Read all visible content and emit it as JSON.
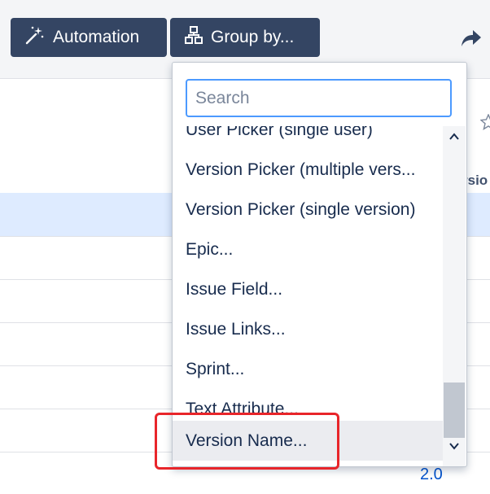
{
  "toolbar": {
    "automation_label": "Automation",
    "groupby_label": "Group by..."
  },
  "table": {
    "column_header_fragment": "rsio",
    "visible_value": "2.0"
  },
  "dropdown": {
    "search_placeholder": "Search",
    "items": [
      {
        "label": "User Picker (single user)"
      },
      {
        "label": "Version Picker (multiple vers..."
      },
      {
        "label": "Version Picker (single version)"
      },
      {
        "label": "Epic..."
      },
      {
        "label": "Issue Field..."
      },
      {
        "label": "Issue Links..."
      },
      {
        "label": "Sprint..."
      },
      {
        "label": "Text Attribute..."
      },
      {
        "label": "Version Name..."
      }
    ],
    "hovered_item": "Version Name..."
  },
  "icons": [
    "magic-wand-icon",
    "hierarchy-icon",
    "share-icon",
    "star-icon",
    "chevron-up-icon",
    "chevron-down-icon"
  ],
  "colors": {
    "button_bg": "#344563",
    "selected_row": "#deebff",
    "focus_border": "#4c9aff",
    "annotation_red": "#e8252a",
    "link_blue": "#0052cc"
  }
}
